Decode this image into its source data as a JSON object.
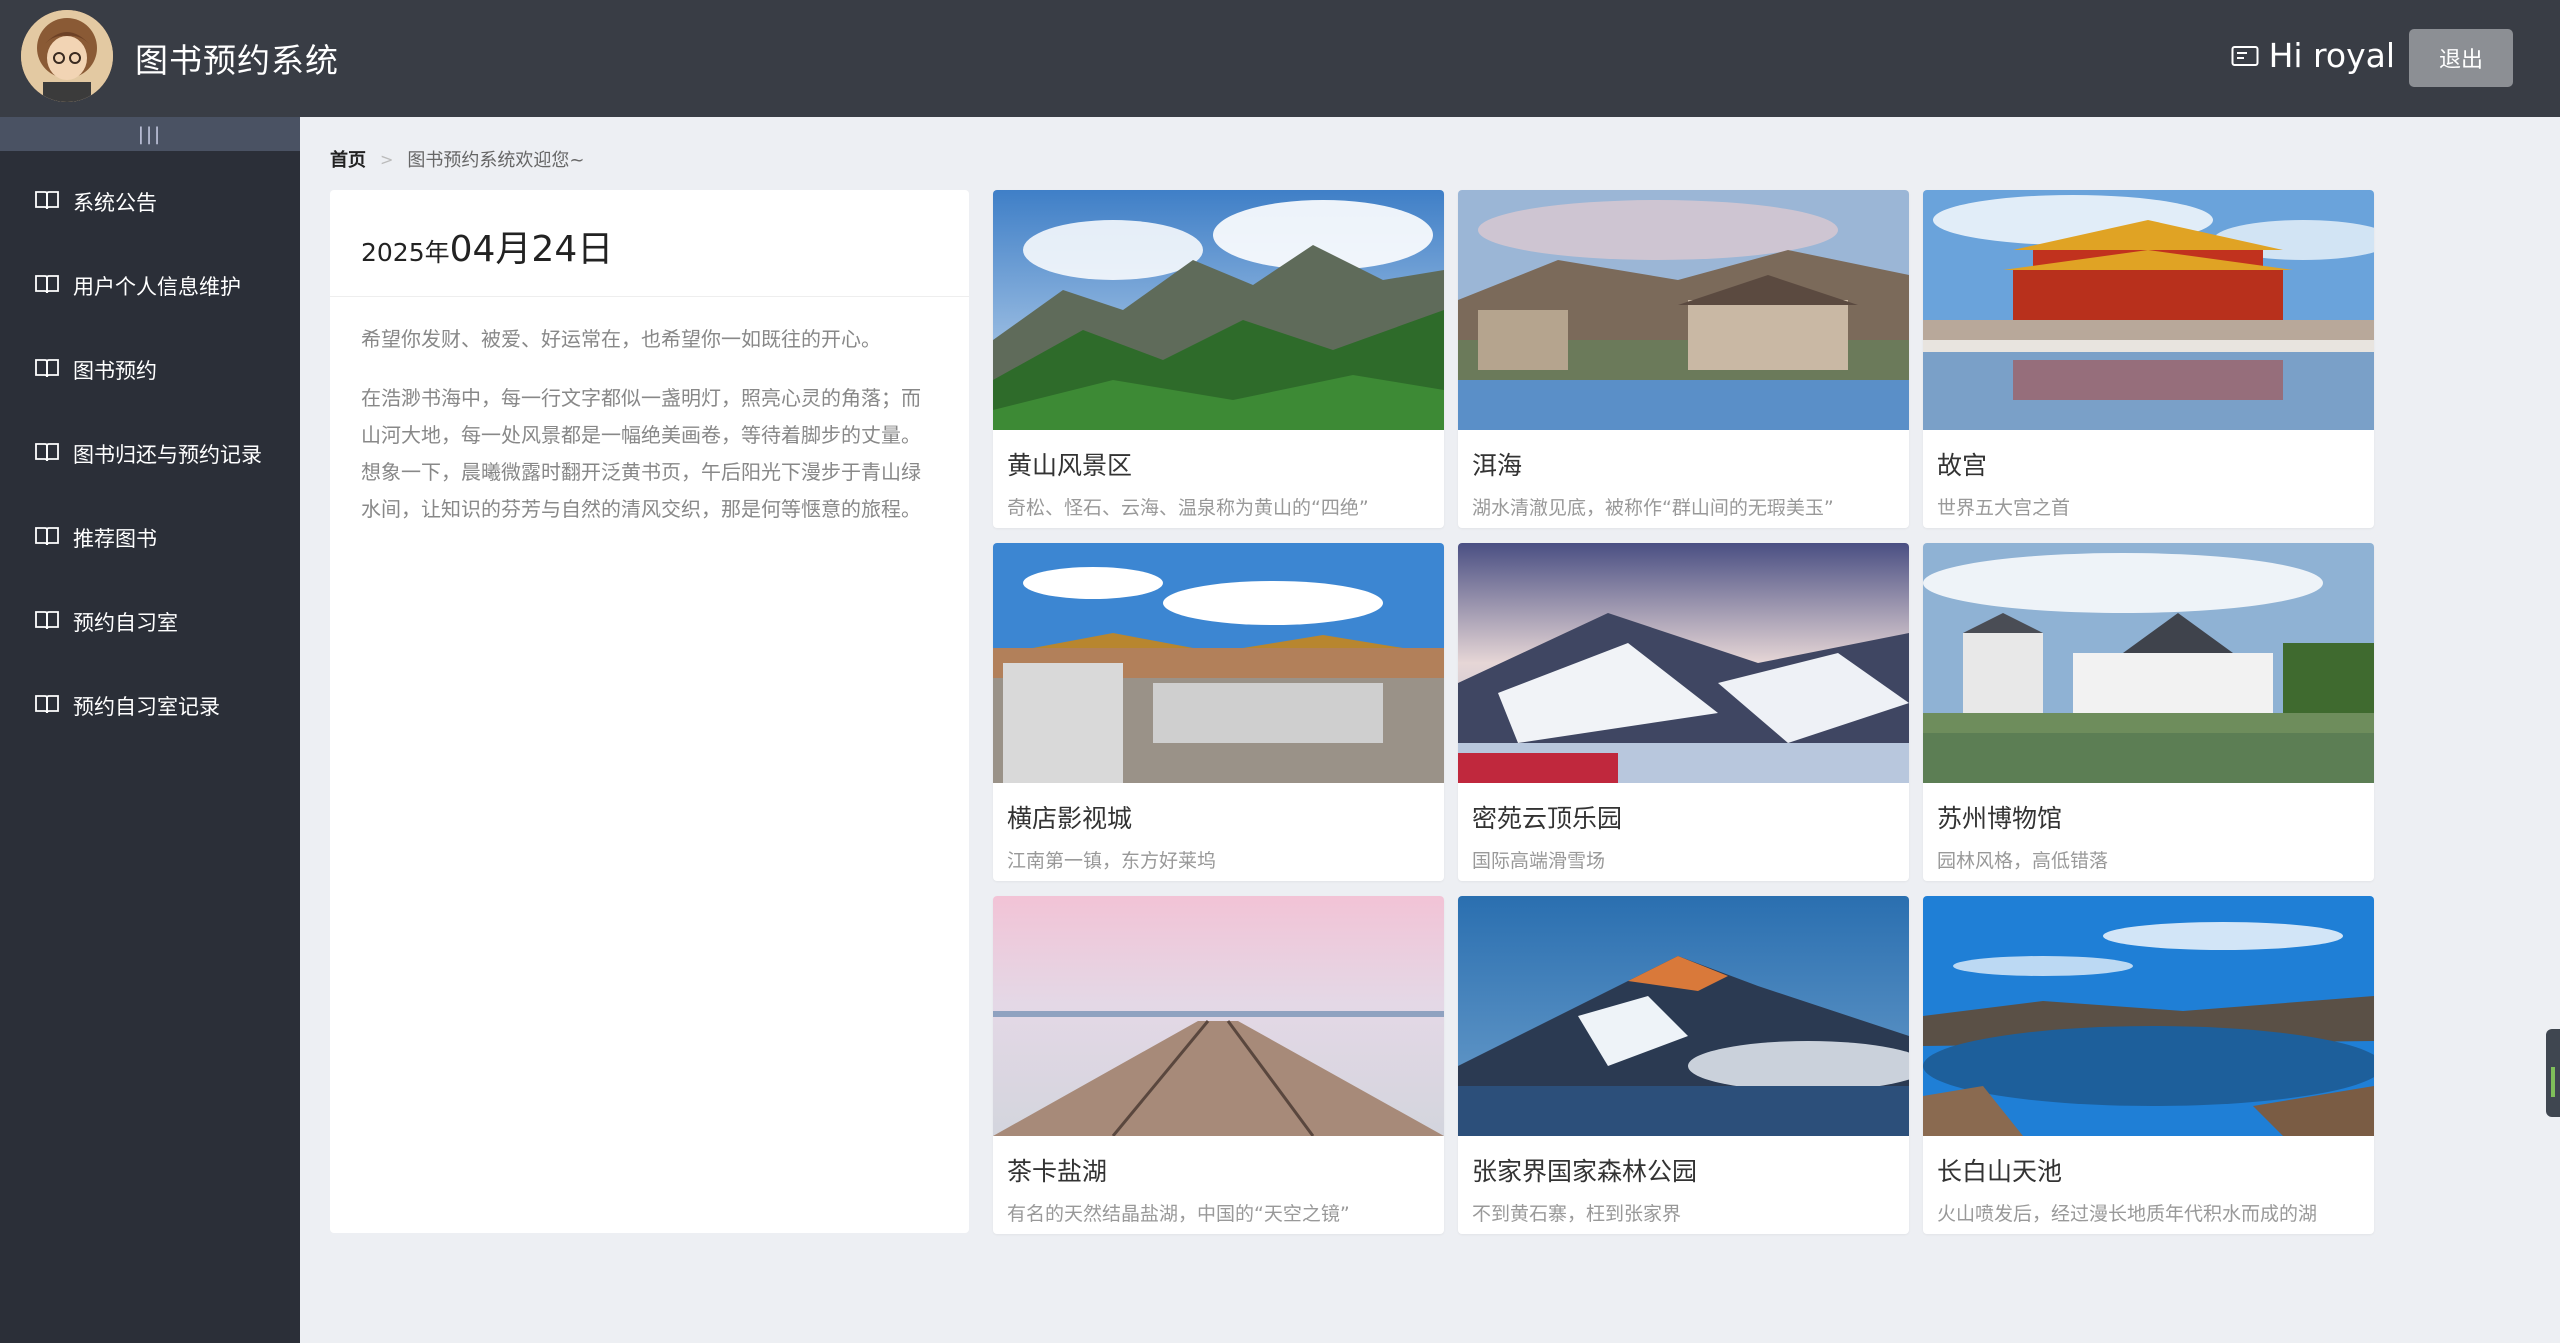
{
  "header": {
    "title": "图书预约系统",
    "greeting": "Hi royal",
    "logout_label": "退出",
    "avatar_icon": "user-avatar",
    "greeting_icon": "id-card-icon"
  },
  "sidebar": {
    "collapse_label": "|||",
    "items": [
      {
        "label": "系统公告",
        "icon": "book-icon"
      },
      {
        "label": "用户个人信息维护",
        "icon": "book-icon"
      },
      {
        "label": "图书预约",
        "icon": "book-icon"
      },
      {
        "label": "图书归还与预约记录",
        "icon": "book-icon"
      },
      {
        "label": "推荐图书",
        "icon": "book-icon"
      },
      {
        "label": "预约自习室",
        "icon": "book-icon"
      },
      {
        "label": "预约自习室记录",
        "icon": "book-icon"
      }
    ]
  },
  "breadcrumb": {
    "home": "首页",
    "separator": ">",
    "current": "图书预约系统欢迎您~"
  },
  "welcome": {
    "year": "2025年",
    "month_day": "04月24日",
    "para1": "希望你发财、被爱、好运常在，也希望你一如既往的开心。",
    "para2": "在浩渺书海中，每一行文字都似一盏明灯，照亮心灵的角落；而山河大地，每一处风景都是一幅绝美画卷，等待着脚步的丈量。想象一下，晨曦微露时翻开泛黄书页，午后阳光下漫步于青山绿水间，让知识的芬芳与自然的清风交织，那是何等惬意的旅程。"
  },
  "cards": [
    {
      "title": "黄山风景区",
      "desc": "奇松、怪石、云海、温泉称为黄山的“四绝”"
    },
    {
      "title": "洱海",
      "desc": "湖水清澈见底，被称作“群山间的无瑕美玉”"
    },
    {
      "title": "故宫",
      "desc": "世界五大宫之首"
    },
    {
      "title": "横店影视城",
      "desc": "江南第一镇，东方好莱坞"
    },
    {
      "title": "密苑云顶乐园",
      "desc": "国际高端滑雪场"
    },
    {
      "title": "苏州博物馆",
      "desc": "园林风格，高低错落"
    },
    {
      "title": "茶卡盐湖",
      "desc": "有名的天然结晶盐湖，中国的“天空之镜”"
    },
    {
      "title": "张家界国家森林公园",
      "desc": "不到黄石寨，枉到张家界"
    },
    {
      "title": "长白山天池",
      "desc": "火山喷发后，经过漫长地质年代积水而成的湖"
    }
  ],
  "colors": {
    "header_bg": "#393d45",
    "sidebar_bg": "#2b2f38",
    "collapse_bg": "#4a5263",
    "page_bg": "#edeff3",
    "logout_bg": "#8c8f94"
  }
}
